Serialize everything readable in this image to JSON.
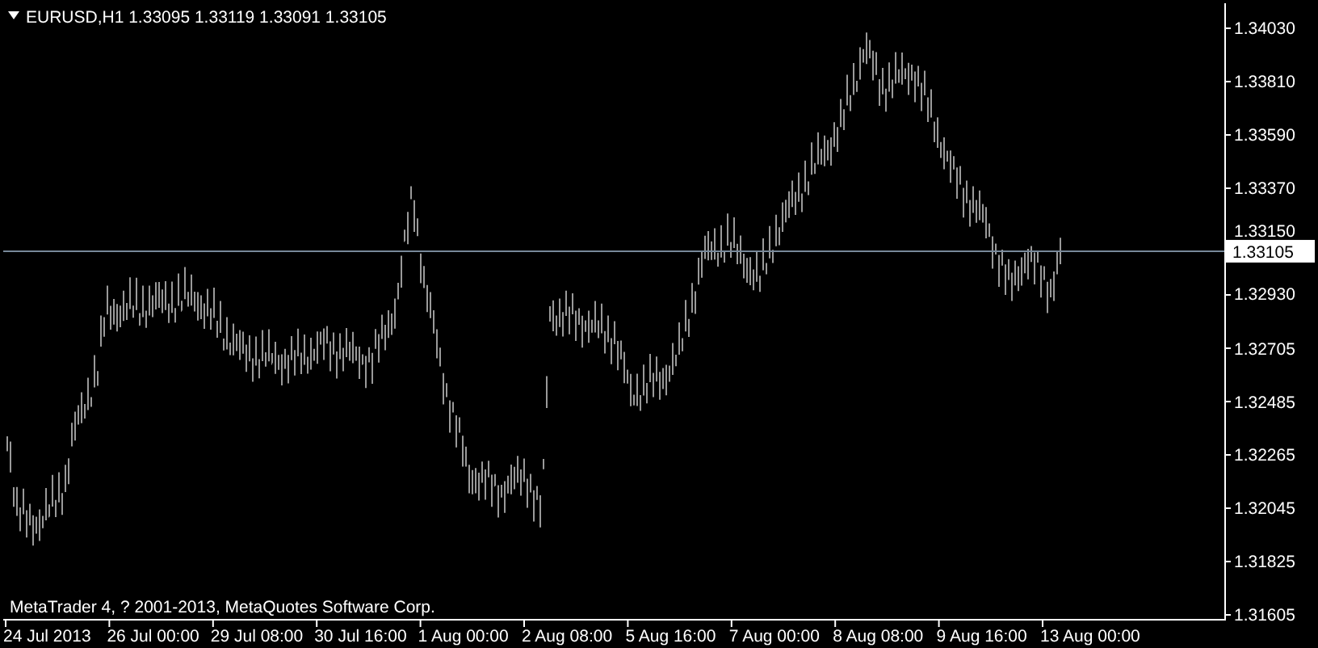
{
  "header": {
    "symbol": "EURUSD,H1",
    "values": [
      "1.33095",
      "1.33119",
      "1.33091",
      "1.33105"
    ]
  },
  "price_axis": {
    "ticks": [
      "1.34030",
      "1.33810",
      "1.33590",
      "1.33370",
      "1.33150",
      "1.32930",
      "1.32705",
      "1.32485",
      "1.32265",
      "1.32045",
      "1.31825",
      "1.31605"
    ],
    "current_price": "1.33105"
  },
  "time_axis": {
    "ticks": [
      "24 Jul 2013",
      "26 Jul 00:00",
      "29 Jul 08:00",
      "30 Jul 16:00",
      "1 Aug 00:00",
      "2 Aug 08:00",
      "5 Aug 16:00",
      "7 Aug 00:00",
      "8 Aug 08:00",
      "9 Aug 16:00",
      "13 Aug 00:00"
    ]
  },
  "copyright": "MetaTrader 4, ? 2001-2013, MetaQuotes Software Corp."
}
